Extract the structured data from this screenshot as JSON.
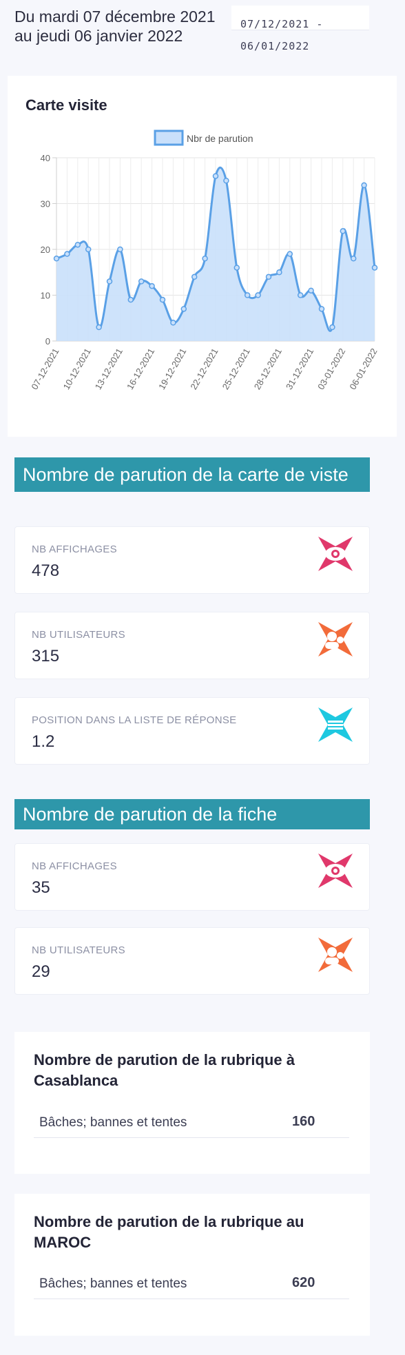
{
  "header": {
    "date_title": "Du mardi 07 décembre 2021 au jeudi 06 janvier 2022",
    "date_start": "07/12/2021 -",
    "date_end": "06/01/2022"
  },
  "chart_card": {
    "title": "Carte visite"
  },
  "chart_data": {
    "type": "line",
    "title": "",
    "legend": [
      "Nbr de parution"
    ],
    "legend_position": "top",
    "color": "#5aa0e6",
    "fill": "#c9e0fb",
    "ylim": [
      0,
      40
    ],
    "yticks": [
      0,
      10,
      20,
      30,
      40
    ],
    "grid": true,
    "x": [
      "07-12-2021",
      "08-12-2021",
      "09-12-2021",
      "10-12-2021",
      "11-12-2021",
      "12-12-2021",
      "13-12-2021",
      "14-12-2021",
      "15-12-2021",
      "16-12-2021",
      "17-12-2021",
      "18-12-2021",
      "19-12-2021",
      "20-12-2021",
      "21-12-2021",
      "22-12-2021",
      "23-12-2021",
      "24-12-2021",
      "25-12-2021",
      "26-12-2021",
      "27-12-2021",
      "28-12-2021",
      "29-12-2021",
      "30-12-2021",
      "31-12-2021",
      "01-01-2022",
      "02-01-2022",
      "03-01-2022",
      "04-01-2022",
      "05-01-2022",
      "06-01-2022"
    ],
    "xtick_labels": [
      "07-12-2021",
      "10-12-2021",
      "13-12-2021",
      "16-12-2021",
      "19-12-2021",
      "22-12-2021",
      "25-12-2021",
      "28-12-2021",
      "31-12-2021",
      "03-01-2022",
      "06-01-2022"
    ],
    "series": [
      {
        "name": "Nbr de parution",
        "values": [
          18,
          19,
          21,
          20,
          3,
          13,
          20,
          9,
          13,
          12,
          9,
          4,
          7,
          14,
          18,
          36,
          35,
          16,
          10,
          10,
          14,
          15,
          19,
          10,
          11,
          7,
          3,
          24,
          18,
          34,
          16
        ]
      }
    ]
  },
  "section_carte": {
    "title": "Nombre de parution de la carte de viste",
    "stats": [
      {
        "label": "NB AFFICHAGES",
        "value": "478",
        "icon": "eye-icon",
        "color": "#e0386b"
      },
      {
        "label": "NB UTILISATEURS",
        "value": "315",
        "icon": "users-icon",
        "color": "#f26b3a"
      },
      {
        "label": "POSITION DANS LA LISTE DE RÉPONSE",
        "value": "1.2",
        "icon": "list-position-icon",
        "color": "#1ec8e0"
      }
    ]
  },
  "section_fiche": {
    "title": "Nombre de parution de la fiche",
    "stats": [
      {
        "label": "NB AFFICHAGES",
        "value": "35",
        "icon": "eye-icon",
        "color": "#e0386b"
      },
      {
        "label": "NB UTILISATEURS",
        "value": "29",
        "icon": "users-icon",
        "color": "#f26b3a"
      }
    ]
  },
  "rubrique_casablanca": {
    "title": "Nombre de parution de la rubrique à Casablanca",
    "rows": [
      {
        "name": "Bâches; bannes et tentes",
        "value": "160"
      }
    ]
  },
  "rubrique_maroc": {
    "title": "Nombre de parution de la rubrique au MAROC",
    "rows": [
      {
        "name": "Bâches; bannes et tentes",
        "value": "620"
      }
    ]
  }
}
